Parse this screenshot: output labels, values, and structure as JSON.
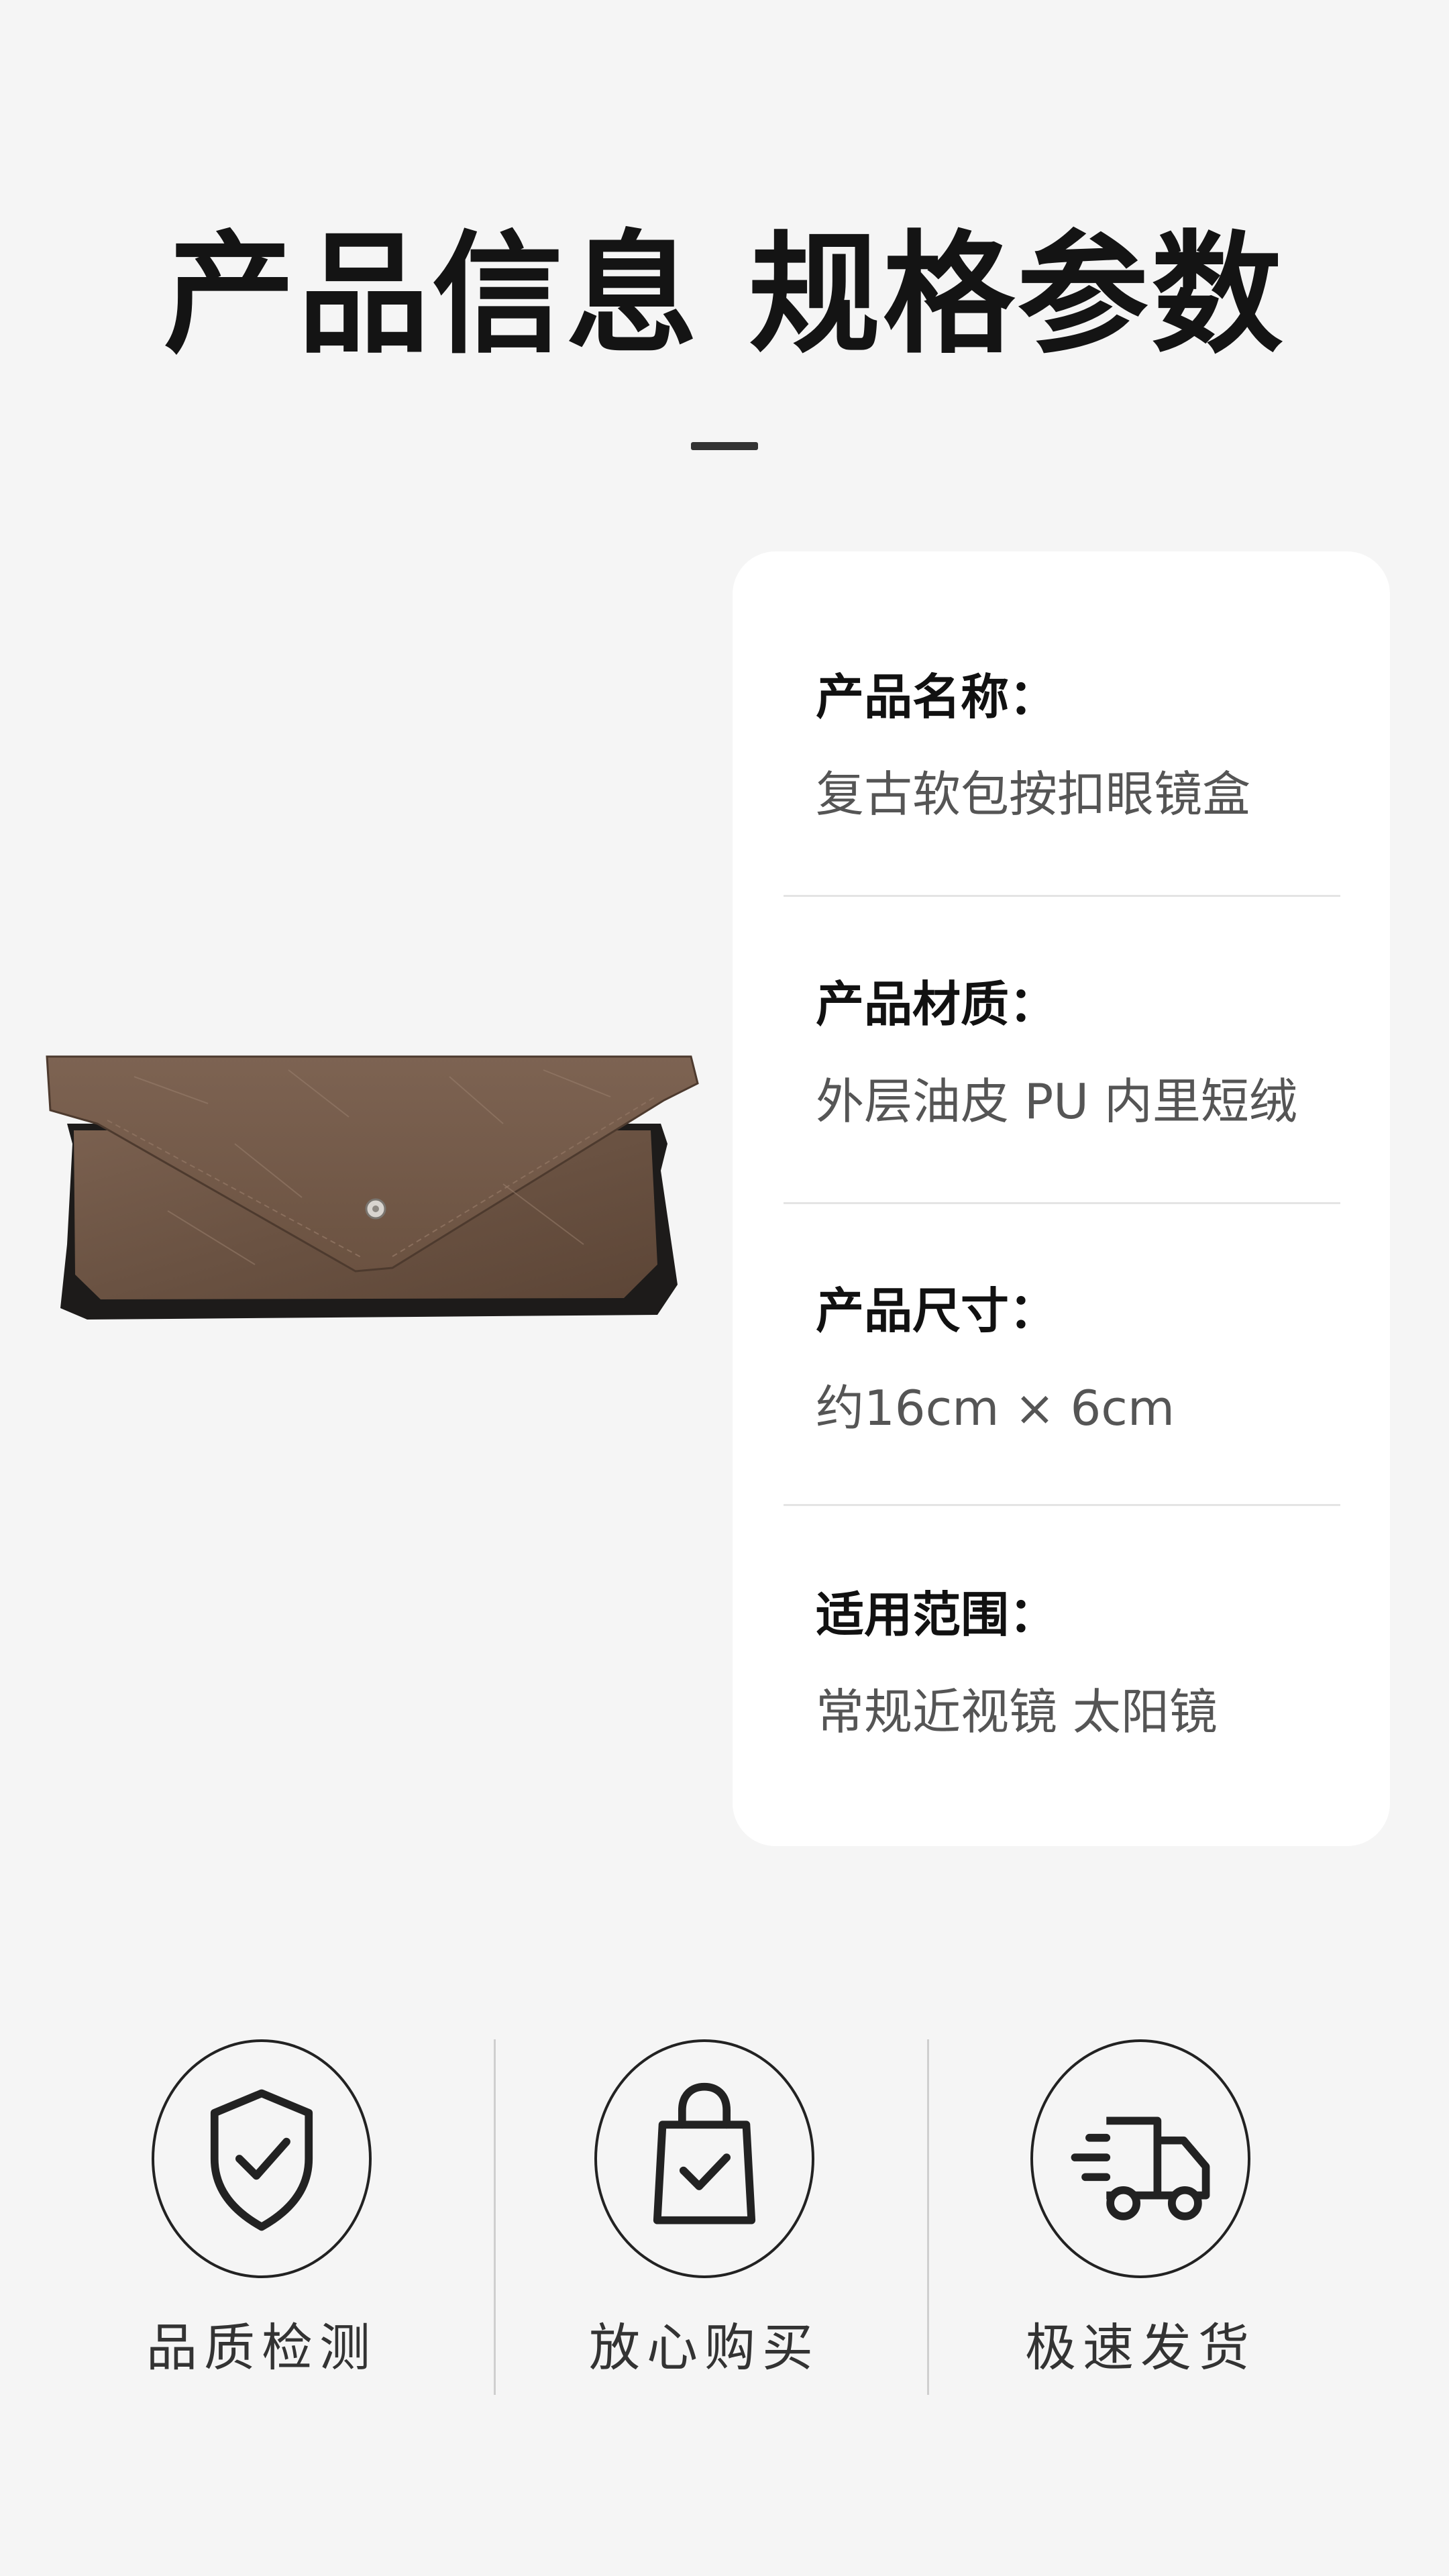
{
  "header": {
    "title": "产品信息 规格参数"
  },
  "product": {
    "image_alt": "leather-glasses-case"
  },
  "specs": [
    {
      "label": "产品名称：",
      "value": "复古软包按扣眼镜盒"
    },
    {
      "label": "产品材质：",
      "value": "外层油皮 PU  内里短绒"
    },
    {
      "label": "产品尺寸：",
      "value": "约16cm × 6cm"
    },
    {
      "label": "适用范围：",
      "value": "常规近视镜 太阳镜"
    }
  ],
  "features": [
    {
      "label": "品质检测",
      "icon": "shield-check-icon"
    },
    {
      "label": "放心购买",
      "icon": "shopping-bag-check-icon"
    },
    {
      "label": "极速发货",
      "icon": "delivery-truck-icon"
    }
  ],
  "colors": {
    "background": "#f5f5f5",
    "card": "#ffffff",
    "leather": "#6e5444",
    "leather_dark": "#1c1a19"
  }
}
